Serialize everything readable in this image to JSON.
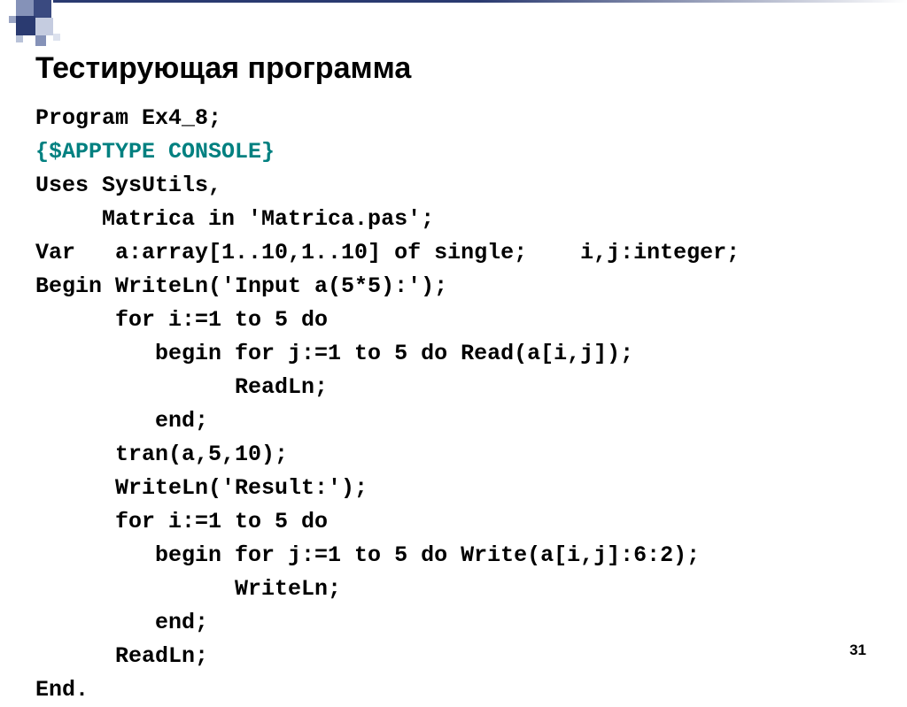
{
  "title": "Тестирующая программа",
  "code": {
    "line1": "Program Ex4_8;",
    "line2": "{$APPTYPE CONSOLE}",
    "line3": "Uses SysUtils,",
    "line4": "     Matrica in 'Matrica.pas';",
    "line5": "Var   a:array[1..10,1..10] of single;    i,j:integer;",
    "line6": "Begin WriteLn('Input a(5*5):');",
    "line7": "      for i:=1 to 5 do",
    "line8": "         begin for j:=1 to 5 do Read(a[i,j]);",
    "line9": "               ReadLn;",
    "line10": "         end;",
    "line11": "      tran(a,5,10);",
    "line12": "      WriteLn('Result:');",
    "line13": "      for i:=1 to 5 do",
    "line14": "         begin for j:=1 to 5 do Write(a[i,j]:6:2);",
    "line15": "               WriteLn;",
    "line16": "         end;",
    "line17": "      ReadLn;",
    "line18": "End."
  },
  "pageNumber": "31"
}
